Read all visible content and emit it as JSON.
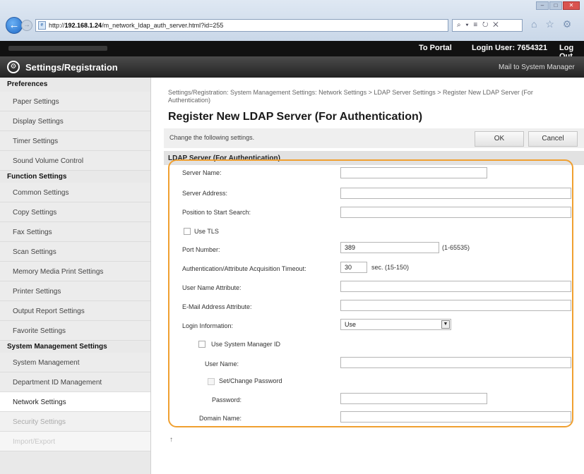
{
  "browser": {
    "url_prefix": "http://",
    "url_host": "192.168.1.24",
    "url_path": "/m_network_ldap_auth_server.html?id=255",
    "addr_tools": "⌕ ▾ ≡ ↻ ✕",
    "window_controls": [
      "–",
      "□",
      "✕"
    ],
    "home_star_gear": "⌂ ☆ ⚙"
  },
  "topbar": {
    "portal_label": "To Portal",
    "login_user": "Login User:  7654321",
    "logout_label": "Log Out"
  },
  "header": {
    "title": "Settings/Registration",
    "mail_label": "Mail to System Manager"
  },
  "sidebar": {
    "preferences_head": "Preferences",
    "preferences": [
      "Paper Settings",
      "Display Settings",
      "Timer Settings",
      "Sound Volume Control"
    ],
    "function_head": "Function Settings",
    "function": [
      "Common Settings",
      "Copy Settings",
      "Fax Settings",
      "Scan Settings",
      "Memory Media Print Settings",
      "Printer Settings",
      "Output Report Settings",
      "Favorite Settings"
    ],
    "system_head": "System Management Settings",
    "system": [
      "System Management",
      "Department ID Management",
      "Network Settings",
      "Security Settings",
      "Import/Export"
    ]
  },
  "main": {
    "breadcrumb": "Settings/Registration: System Management Settings: Network Settings > LDAP Server Settings > Register New LDAP Server (For Authentication)",
    "title": "Register New LDAP Server (For Authentication)",
    "instruction": "Change the following settings.",
    "ok_label": "OK",
    "cancel_label": "Cancel",
    "section_head": "LDAP Server (For Authentication)",
    "labels": {
      "server_name": "Server Name:",
      "server_address": "Server Address:",
      "position_search": "Position to Start Search:",
      "use_tls": "Use TLS",
      "port_number": "Port Number:",
      "port_range": "(1-65535)",
      "timeout": "Authentication/Attribute Acquisition Timeout:",
      "timeout_unit": "sec. (15-150)",
      "user_name_attr": "User Name Attribute:",
      "email_attr": "E-Mail Address Attribute:",
      "login_info": "Login Information:",
      "use_sys_mgr_id": "Use System Manager ID",
      "user_name": "User Name:",
      "set_change_password": "Set/Change Password",
      "password": "Password:",
      "domain_name": "Domain Name:"
    },
    "values": {
      "server_name": "",
      "server_address": "",
      "position_search": "",
      "port_number": "389",
      "timeout": "30",
      "user_name_attr": "",
      "email_attr": "",
      "login_info": "Use",
      "user_name": "",
      "password": "",
      "domain_name": ""
    },
    "top_link": "↑"
  },
  "colors": {
    "highlight": "#f0a030",
    "settings_bar": "#2c2c2c",
    "top_bar": "#111111"
  }
}
